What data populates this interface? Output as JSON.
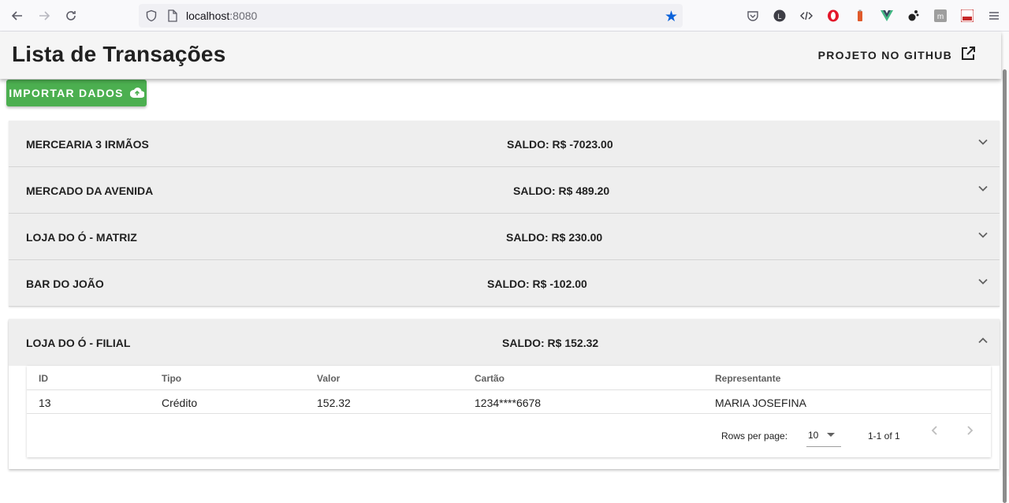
{
  "browser": {
    "url_host": "localhost",
    "url_port": ":8080"
  },
  "header": {
    "title": "Lista de Transações",
    "github_label": "PROJETO NO GITHUB"
  },
  "import_button": {
    "label": "IMPORTAR DADOS"
  },
  "stores": [
    {
      "name": "MERCEARIA 3 IRMÃOS",
      "saldo": "SALDO: R$ -7023.00"
    },
    {
      "name": "MERCADO DA AVENIDA",
      "saldo": "SALDO: R$ 489.20"
    },
    {
      "name": "LOJA DO Ó - MATRIZ",
      "saldo": "SALDO: R$ 230.00"
    },
    {
      "name": "BAR DO JOÃO",
      "saldo": "SALDO: R$ -102.00"
    }
  ],
  "expanded_store": {
    "name": "LOJA DO Ó - FILIAL",
    "saldo": "SALDO: R$ 152.32",
    "table": {
      "headers": [
        "ID",
        "Tipo",
        "Valor",
        "Cartão",
        "Representante"
      ],
      "rows": [
        [
          "13",
          "Crédito",
          "152.32",
          "1234****6678",
          "MARIA JOSEFINA"
        ]
      ],
      "rows_per_page_label": "Rows per page:",
      "rows_per_page_value": "10",
      "page_info": "1-1 of 1"
    }
  },
  "colors": {
    "accent_green": "#4caf50",
    "star_blue": "#0b62da"
  }
}
